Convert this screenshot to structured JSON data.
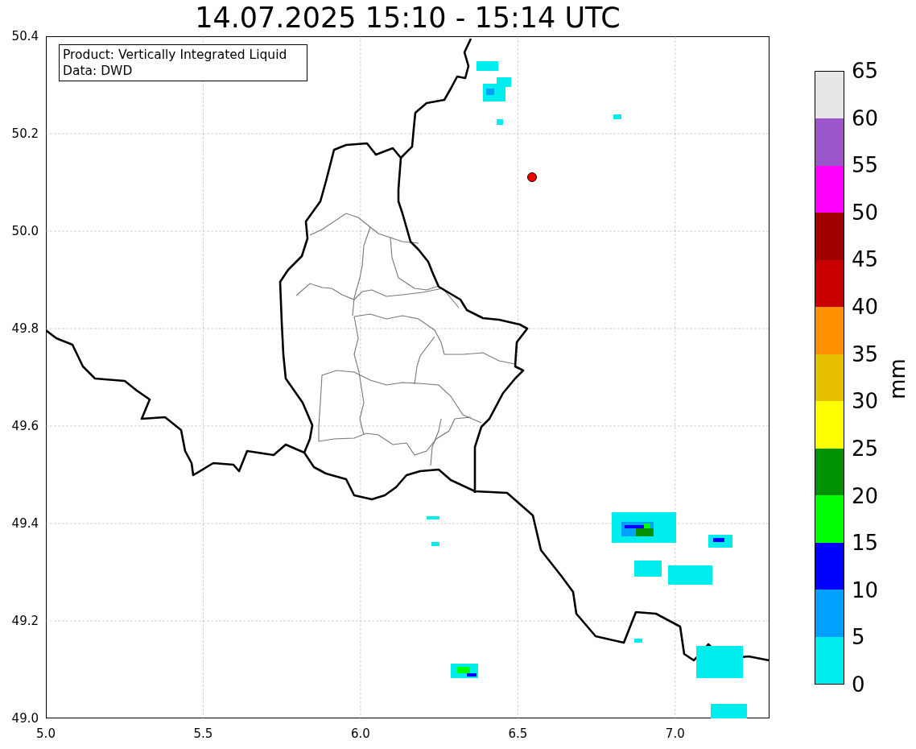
{
  "title": "14.07.2025 15:10 - 15:14 UTC",
  "info_box": [
    "Product: Vertically Integrated Liquid",
    "Data: DWD"
  ],
  "map": {
    "x_ticks": [
      "5.0",
      "5.5",
      "6.0",
      "6.5",
      "7.0"
    ],
    "y_ticks": [
      "50.4",
      "50.2",
      "50.0",
      "49.8",
      "49.6",
      "49.4",
      "49.2",
      "49.0"
    ]
  },
  "colorbar": {
    "label": "mm",
    "ticks": [
      "65",
      "60",
      "55",
      "50",
      "45",
      "40",
      "35",
      "30",
      "25",
      "20",
      "15",
      "10",
      "5",
      "0"
    ],
    "bands": [
      {
        "color": "#00eded"
      },
      {
        "color": "#00a0ff"
      },
      {
        "color": "#0000ff"
      },
      {
        "color": "#00ff00"
      },
      {
        "color": "#009000"
      },
      {
        "color": "#ffff00"
      },
      {
        "color": "#e7c000"
      },
      {
        "color": "#ff9000"
      },
      {
        "color": "#c80000"
      },
      {
        "color": "#a00000"
      },
      {
        "color": "#ff00ff"
      },
      {
        "color": "#9955c9"
      },
      {
        "color": "#e6e6e6"
      }
    ]
  }
}
